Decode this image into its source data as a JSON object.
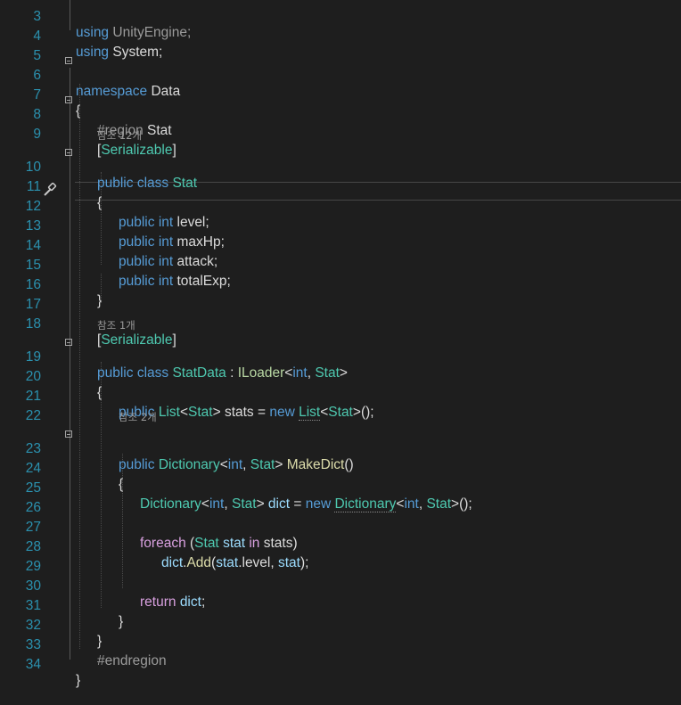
{
  "line_numbers": [
    "3",
    "4",
    "5",
    "6",
    "7",
    "8",
    "9",
    "10",
    "11",
    "12",
    "13",
    "14",
    "15",
    "16",
    "17",
    "18",
    "19",
    "20",
    "21",
    "22",
    "23",
    "24",
    "25",
    "26",
    "27",
    "28",
    "29",
    "30",
    "31",
    "32",
    "33",
    "34"
  ],
  "codelens": {
    "stat_refs": "참조 12개",
    "statdata_refs": "참조 1개",
    "makedict_refs": "참조 2개"
  },
  "code": {
    "l3": {
      "kw": "using",
      "ns": "UnityEngine;"
    },
    "l4": {
      "kw": "using",
      "ns": "System;"
    },
    "l6": {
      "kw": "namespace",
      "name": "Data"
    },
    "l7": "{",
    "l8": {
      "dir": "#region",
      "name": "Stat"
    },
    "l9": {
      "open": "[",
      "attr": "Serializable",
      "close": "]"
    },
    "l10": {
      "kw1": "public",
      "kw2": "class",
      "name": "Stat"
    },
    "l11": "{",
    "l12": {
      "kw1": "public",
      "kw2": "int",
      "rest": "level;"
    },
    "l13": {
      "kw1": "public",
      "kw2": "int",
      "rest": "maxHp;"
    },
    "l14": {
      "kw1": "public",
      "kw2": "int",
      "rest": "attack;"
    },
    "l15": {
      "kw1": "public",
      "kw2": "int",
      "rest": "totalExp;"
    },
    "l16": "}",
    "l18": {
      "open": "[",
      "attr": "Serializable",
      "close": "]"
    },
    "l19": {
      "kw1": "public",
      "kw2": "class",
      "name": "StatData",
      "colon": " : ",
      "iface": "ILoader",
      "lt": "<",
      "t1": "int",
      "comma": ", ",
      "t2": "Stat",
      "gt": ">"
    },
    "l20": "{",
    "l21": {
      "kw": "public",
      "type": "List",
      "lt": "<",
      "arg": "Stat",
      "gt": ">",
      "mid": " stats = ",
      "new": "new",
      "type2": "List",
      "lt2": "<",
      "arg2": "Stat",
      "gt2": ">",
      "end": "();"
    },
    "l23": {
      "kw": "public",
      "type": "Dictionary",
      "lt": "<",
      "t1": "int",
      "comma": ", ",
      "t2": "Stat",
      "gt": "> ",
      "method": "MakeDict",
      "end": "()"
    },
    "l24": "{",
    "l25": {
      "type": "Dictionary",
      "lt": "<",
      "t1": "int",
      "comma": ", ",
      "t2": "Stat",
      "gt": "> ",
      "var": "dict",
      "eq": " = ",
      "new": "new",
      "type2": "Dictionary",
      "lt2": "<",
      "t3": "int",
      "comma2": ", ",
      "t4": "Stat",
      "end": ">();"
    },
    "l27": {
      "kw": "foreach",
      "open": " (",
      "type": "Stat",
      "var": "stat",
      "in": "in",
      "col": "stats",
      "close": ")"
    },
    "l28": {
      "obj": "dict",
      "dot": ".",
      "method": "Add",
      "open": "(",
      "a1": "stat",
      "a1b": ".level, ",
      "a2": "stat",
      "end": ");"
    },
    "l30": {
      "kw": "return",
      "var": "dict",
      "end": ";"
    },
    "l31": "}",
    "l32": "}",
    "l33": {
      "dir": "#endregion"
    },
    "l34": "}"
  },
  "colors": {
    "background": "#1e1e1e",
    "keyword": "#569cd6",
    "control": "#d8a0df",
    "type": "#4ec9b0",
    "interface": "#b8d7a3",
    "method": "#dcdcaa",
    "variable": "#9cdcfe",
    "line_number": "#2b91af"
  },
  "icons": {
    "quick_action": "screwdriver-icon",
    "fold": "collapse-box-icon"
  }
}
